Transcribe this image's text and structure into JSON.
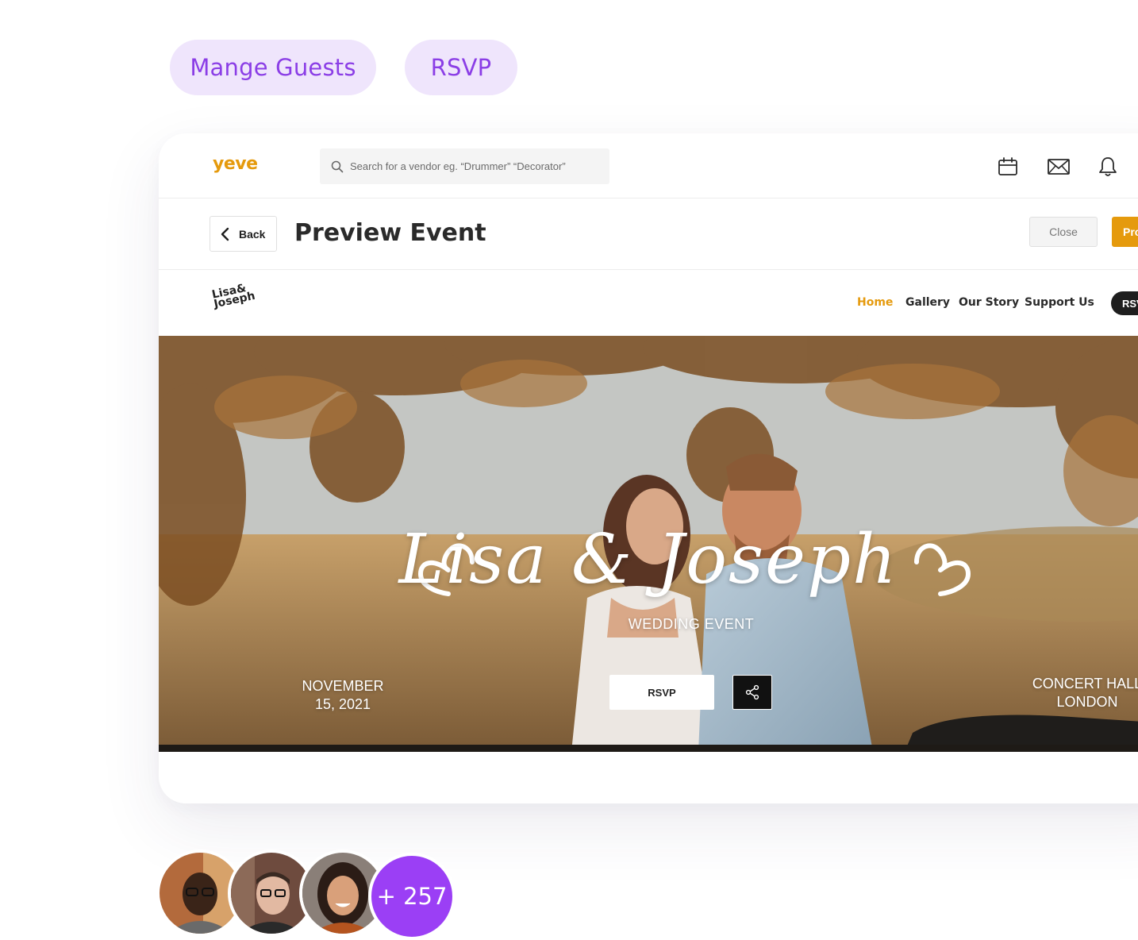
{
  "pills": {
    "manage_guests": "Mange Guests",
    "rsvp": "RSVP"
  },
  "topbar": {
    "brand": "yeve",
    "search_placeholder": "Search for a vendor eg. “Drummer” “Decorator”",
    "icons": [
      "calendar-icon",
      "mail-icon",
      "bell-icon"
    ]
  },
  "subbar": {
    "back_label": "Back",
    "title": "Preview Event",
    "close_label": "Close",
    "proceed_label": "Pro"
  },
  "site": {
    "logo_line1": "Lisa&",
    "logo_line2": "Joseph",
    "nav": [
      {
        "label": "Home",
        "active": true
      },
      {
        "label": "Gallery",
        "active": false
      },
      {
        "label": "Our Story",
        "active": false
      },
      {
        "label": "Support Us",
        "active": false
      }
    ],
    "nav_rsvp": "RSV"
  },
  "hero": {
    "names": "Lisa & Joseph",
    "subtitle": "WEDDING EVENT",
    "date_line1": "NOVEMBER",
    "date_line2": "15, 2021",
    "venue_line1": "CONCERT HALL",
    "venue_line2": "LONDON",
    "rsvp_label": "RSVP"
  },
  "guests": {
    "more_count": "+ 257"
  },
  "colors": {
    "accent": "#e59a0d",
    "purple": "#9b3ff5",
    "pill_bg": "#efe5fc",
    "pill_text": "#8b3ee6"
  }
}
